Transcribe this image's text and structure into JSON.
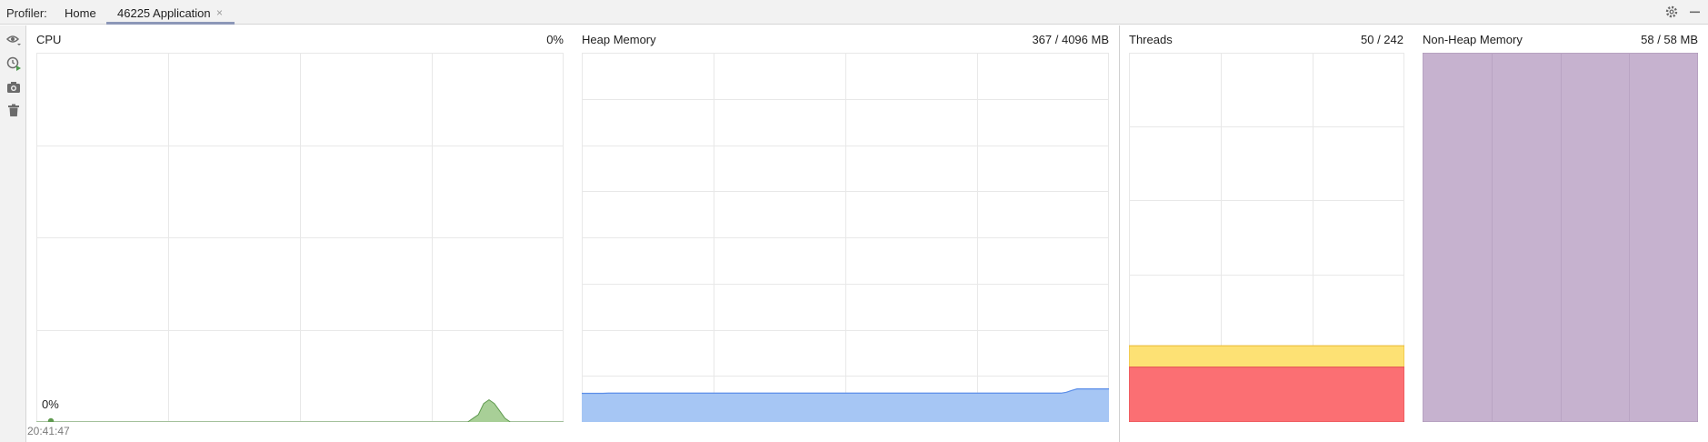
{
  "header": {
    "profiler_label": "Profiler:",
    "tabs": [
      {
        "label": "Home"
      },
      {
        "label": "46225 Application"
      }
    ],
    "close_glyph": "×",
    "right_icons": [
      "gear-icon",
      "minimize-icon"
    ]
  },
  "toolbar": {
    "icons": [
      "eye-icon",
      "record-icon",
      "camera-icon",
      "trash-icon"
    ]
  },
  "panels": {
    "cpu": {
      "title": "CPU",
      "value": "0%",
      "inline_value": "0%",
      "time_label": "20:41:47"
    },
    "heap": {
      "title": "Heap Memory",
      "value": "367 / 4096 MB"
    },
    "threads": {
      "title": "Threads",
      "value": "50 / 242"
    },
    "nonheap": {
      "title": "Non-Heap Memory",
      "value": "58 / 58 MB"
    }
  },
  "colors": {
    "cpu_line": "#5f9a4f",
    "cpu_fill": "#a8cf97",
    "heap_fill": "#a6c6f4",
    "heap_line": "#5b8ee8",
    "threads_yellow": "#fde174",
    "threads_red": "#fb6f73",
    "nonheap_fill": "#c6b2cf",
    "grid": "#e8e8e8"
  },
  "chart_data": [
    {
      "type": "area",
      "title": "CPU",
      "ylim": [
        0,
        100
      ],
      "series": [
        {
          "values": [
            0,
            0,
            0,
            0,
            0,
            0,
            0,
            0,
            0,
            0,
            0,
            0,
            0,
            0,
            0,
            0,
            0,
            0,
            0,
            0,
            0,
            0,
            0,
            0,
            0,
            0,
            0,
            0,
            0,
            0,
            0,
            0,
            0,
            0,
            0,
            0,
            0,
            0,
            0,
            0,
            0,
            0,
            0,
            0,
            0,
            0,
            0,
            0,
            0,
            0,
            0,
            0,
            0,
            0,
            0,
            0,
            0,
            0,
            0,
            0,
            0,
            0,
            0,
            0,
            0,
            0,
            0,
            0,
            0,
            0,
            0,
            0,
            0,
            0,
            0,
            0,
            0,
            0,
            0,
            0,
            0,
            0,
            1,
            2,
            5,
            6,
            5,
            3,
            1,
            0,
            0,
            0,
            0,
            0,
            0,
            0,
            0,
            0,
            0,
            0
          ]
        }
      ]
    },
    {
      "type": "area",
      "title": "Heap Memory",
      "ylim": [
        0,
        4096
      ],
      "series": [
        {
          "values": [
            318,
            318,
            318,
            318,
            318,
            320,
            320,
            320,
            320,
            320,
            320,
            320,
            320,
            320,
            320,
            320,
            320,
            320,
            320,
            320,
            320,
            320,
            320,
            320,
            320,
            320,
            320,
            320,
            320,
            320,
            320,
            320,
            320,
            320,
            320,
            320,
            320,
            320,
            320,
            320,
            320,
            320,
            320,
            320,
            320,
            320,
            320,
            320,
            320,
            320,
            320,
            320,
            320,
            320,
            320,
            320,
            320,
            320,
            320,
            320,
            320,
            320,
            320,
            320,
            320,
            320,
            320,
            320,
            320,
            320,
            320,
            320,
            320,
            320,
            320,
            320,
            320,
            320,
            320,
            320,
            320,
            320,
            320,
            320,
            320,
            320,
            320,
            320,
            320,
            320,
            320,
            330,
            350,
            367,
            367,
            367,
            367,
            367,
            367,
            367
          ]
        }
      ]
    },
    {
      "type": "area",
      "title": "Threads",
      "ylim": [
        0,
        242
      ],
      "series": [
        {
          "values": [
            36,
            36
          ]
        },
        {
          "values": [
            50,
            50
          ]
        }
      ]
    },
    {
      "type": "area",
      "title": "Non-Heap Memory",
      "ylim": [
        0,
        58
      ],
      "series": [
        {
          "values": [
            58,
            58
          ]
        }
      ]
    }
  ]
}
